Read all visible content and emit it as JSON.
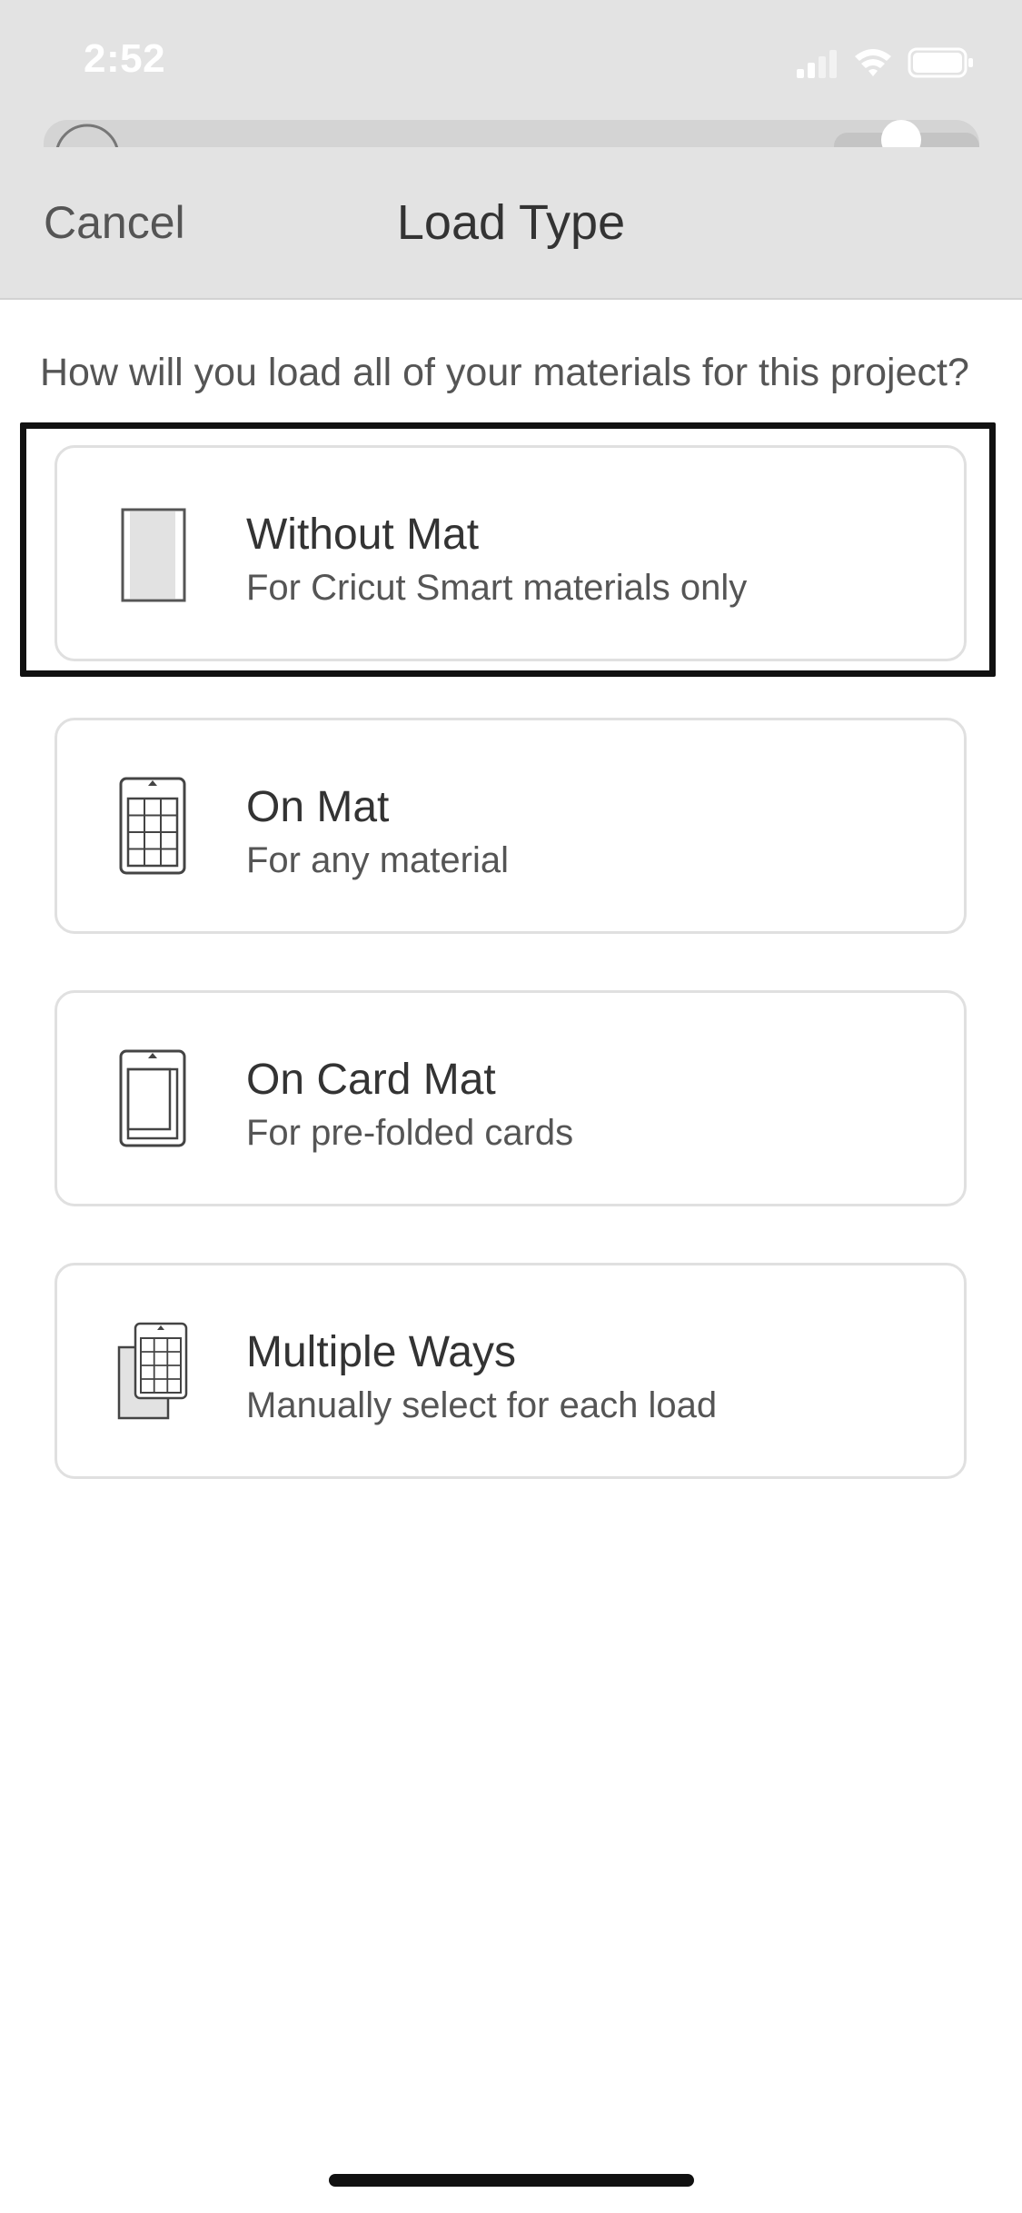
{
  "status_bar": {
    "time": "2:52"
  },
  "nav": {
    "cancel_label": "Cancel",
    "title": "Load Type"
  },
  "question": "How will you load all of your materials for this project?",
  "options": [
    {
      "title": "Without Mat",
      "subtitle": "For Cricut Smart materials only",
      "icon": "material-sheet-icon",
      "selected": true
    },
    {
      "title": "On Mat",
      "subtitle": "For any material",
      "icon": "cutting-mat-icon",
      "selected": false
    },
    {
      "title": "On Card Mat",
      "subtitle": "For pre-folded cards",
      "icon": "card-mat-icon",
      "selected": false
    },
    {
      "title": "Multiple Ways",
      "subtitle": "Manually select for each load",
      "icon": "multiple-ways-icon",
      "selected": false
    }
  ],
  "colors": {
    "header_bg": "#e3e3e3",
    "card_border": "#e0e0e0",
    "focus_ring": "#111111",
    "text_primary": "#333333",
    "text_secondary": "#555555"
  }
}
